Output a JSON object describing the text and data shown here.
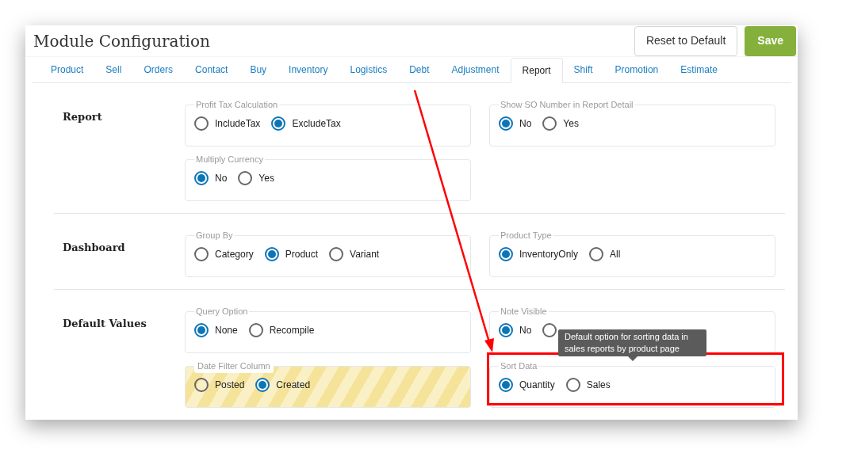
{
  "title": "Module Configuration",
  "buttons": [
    {
      "kind": "reset",
      "label": "Reset to Default"
    },
    {
      "kind": "save",
      "label": "Save"
    }
  ],
  "tabs": [
    {
      "label": "Product",
      "selected": false
    },
    {
      "label": "Sell",
      "selected": false
    },
    {
      "label": "Orders",
      "selected": false
    },
    {
      "label": "Contact",
      "selected": false
    },
    {
      "label": "Buy",
      "selected": false
    },
    {
      "label": "Inventory",
      "selected": false
    },
    {
      "label": "Logistics",
      "selected": false
    },
    {
      "label": "Debt",
      "selected": false
    },
    {
      "label": "Adjustment",
      "selected": false
    },
    {
      "label": "Report",
      "selected": true
    },
    {
      "label": "Shift",
      "selected": false
    },
    {
      "label": "Promotion",
      "selected": false
    },
    {
      "label": "Estimate",
      "selected": false
    }
  ],
  "sections": [
    {
      "title": "Report",
      "groups": [
        {
          "legend": "Profit Tax Calculation",
          "highlighted": false,
          "annotated": false,
          "options": [
            {
              "label": "IncludeTax",
              "selected": false
            },
            {
              "label": "ExcludeTax",
              "selected": true
            }
          ]
        },
        {
          "legend": "Show SO Number in Report Detail",
          "highlighted": false,
          "annotated": false,
          "options": [
            {
              "label": "No",
              "selected": true
            },
            {
              "label": "Yes",
              "selected": false
            }
          ]
        },
        {
          "legend": "Multiply Currency",
          "highlighted": false,
          "annotated": false,
          "options": [
            {
              "label": "No",
              "selected": true
            },
            {
              "label": "Yes",
              "selected": false
            }
          ]
        }
      ]
    },
    {
      "title": "Dashboard",
      "groups": [
        {
          "legend": "Group By",
          "highlighted": false,
          "annotated": false,
          "options": [
            {
              "label": "Category",
              "selected": false
            },
            {
              "label": "Product",
              "selected": true
            },
            {
              "label": "Variant",
              "selected": false
            }
          ]
        },
        {
          "legend": "Product Type",
          "highlighted": false,
          "annotated": false,
          "options": [
            {
              "label": "InventoryOnly",
              "selected": true
            },
            {
              "label": "All",
              "selected": false
            }
          ]
        }
      ]
    },
    {
      "title": "Default Values",
      "groups": [
        {
          "legend": "Query Option",
          "highlighted": false,
          "annotated": false,
          "options": [
            {
              "label": "None",
              "selected": true
            },
            {
              "label": "Recompile",
              "selected": false
            }
          ]
        },
        {
          "legend": "Note Visible",
          "highlighted": false,
          "annotated": false,
          "options": [
            {
              "label": "No",
              "selected": true
            },
            {
              "selected": false
            }
          ]
        },
        {
          "legend": "Date Filter Column",
          "highlighted": true,
          "annotated": false,
          "options": [
            {
              "label": "Posted",
              "selected": false
            },
            {
              "label": "Created",
              "selected": true
            }
          ]
        },
        {
          "legend": "Sort Data",
          "highlighted": false,
          "annotated": true,
          "options": [
            {
              "label": "Quantity",
              "selected": true
            },
            {
              "label": "Sales",
              "selected": false
            }
          ]
        }
      ]
    }
  ],
  "tooltip": {
    "text": "Default option for sorting data in sales reports by product page"
  }
}
